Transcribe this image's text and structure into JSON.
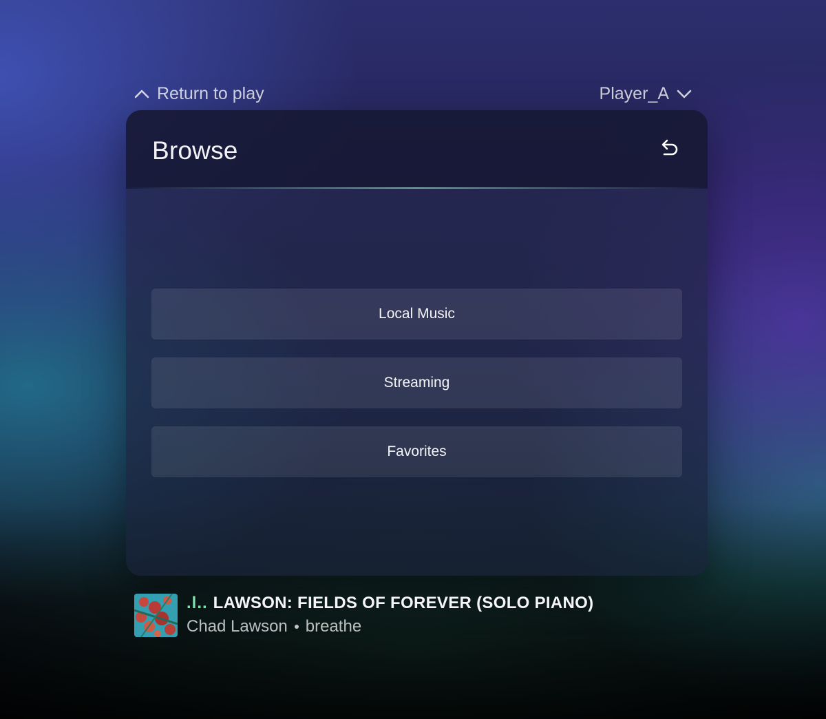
{
  "topbar": {
    "return_label": "Return to play",
    "return_icon": "chevron-up-icon",
    "player_label": "Player_A",
    "player_icon": "chevron-down-icon"
  },
  "panel": {
    "title": "Browse",
    "back_icon": "undo-arrow-icon",
    "buttons": [
      {
        "label": "Local Music"
      },
      {
        "label": "Streaming"
      },
      {
        "label": "Favorites"
      }
    ]
  },
  "now_playing": {
    "eq_text": ".l..",
    "title": "LAWSON: FIELDS OF FOREVER (SOLO PIANO)",
    "artist": "Chad Lawson",
    "album": "breathe",
    "eq_color": "#7fe0b0"
  },
  "colors": {
    "accent_line": "#96dccd",
    "button_bg": "rgba(255,255,255,0.09)"
  }
}
